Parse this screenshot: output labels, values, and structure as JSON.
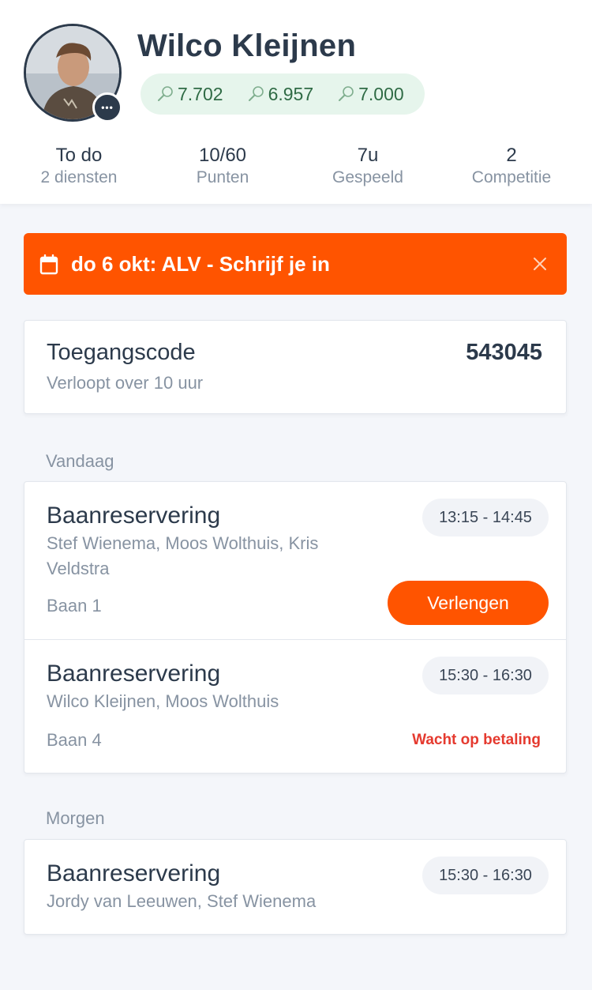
{
  "profile": {
    "name": "Wilco Kleijnen",
    "more_label": "•••",
    "ratings": [
      {
        "icon": "racket-icon",
        "value": "7.702"
      },
      {
        "icon": "racket-icon",
        "value": "6.957"
      },
      {
        "icon": "racket-icon",
        "value": "7.000"
      }
    ]
  },
  "stats": [
    {
      "value": "To do",
      "label": "2 diensten"
    },
    {
      "value": "10/60",
      "label": "Punten"
    },
    {
      "value": "7u",
      "label": "Gespeeld"
    },
    {
      "value": "2",
      "label": "Competitie"
    }
  ],
  "announcement": {
    "icon": "calendar-icon",
    "text": "do 6 okt: ALV - Schrijf je in",
    "close_icon": "close-icon"
  },
  "access": {
    "title": "Toegangscode",
    "subtitle": "Verloopt over 10 uur",
    "code": "543045"
  },
  "sections": {
    "today_label": "Vandaag",
    "tomorrow_label": "Morgen"
  },
  "today": [
    {
      "title": "Baanreservering",
      "players": "Stef Wienema, Moos Wolthuis, Kris Veldstra",
      "time": "13:15 - 14:45",
      "court": "Baan 1",
      "action": "Verlengen"
    },
    {
      "title": "Baanreservering",
      "players": "Wilco Kleijnen, Moos Wolthuis",
      "time": "15:30 - 16:30",
      "court": "Baan 4",
      "status": "Wacht op betaling"
    }
  ],
  "tomorrow": [
    {
      "title": "Baanreservering",
      "players": "Jordy van Leeuwen, Stef Wienema",
      "time": "15:30 - 16:30"
    }
  ],
  "colors": {
    "accent": "#ff5400",
    "rating_bg": "#e6f5ec",
    "rating_text": "#2f6b45",
    "unpaid": "#e53a2f",
    "dark": "#2c3a4b"
  }
}
